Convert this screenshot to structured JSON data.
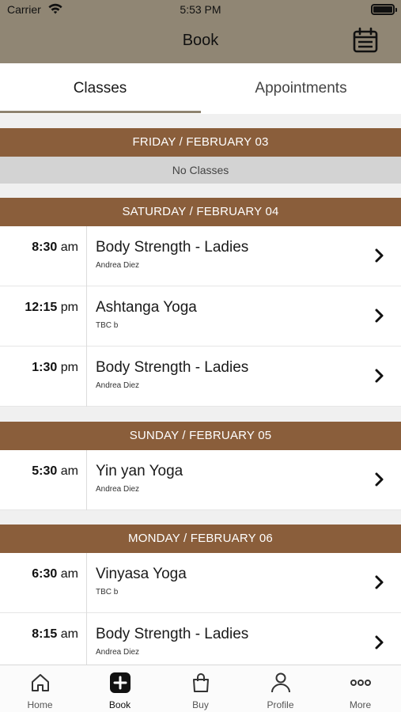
{
  "status_bar": {
    "carrier": "Carrier",
    "time": "5:53 PM"
  },
  "nav": {
    "title": "Book",
    "calendar_icon": "calendar-icon"
  },
  "tabs": [
    {
      "label": "Classes",
      "active": true
    },
    {
      "label": "Appointments",
      "active": false
    }
  ],
  "days": [
    {
      "header": "FRIDAY / FEBRUARY 03",
      "empty_text": "No Classes",
      "classes": []
    },
    {
      "header": "SATURDAY / FEBRUARY 04",
      "classes": [
        {
          "time_num": "8:30",
          "time_suffix": "am",
          "title": "Body Strength - Ladies",
          "instructor": "Andrea Diez"
        },
        {
          "time_num": "12:15",
          "time_suffix": "pm",
          "title": "Ashtanga Yoga",
          "instructor": "TBC b"
        },
        {
          "time_num": "1:30",
          "time_suffix": "pm",
          "title": "Body Strength - Ladies",
          "instructor": "Andrea Diez"
        }
      ]
    },
    {
      "header": "SUNDAY / FEBRUARY 05",
      "classes": [
        {
          "time_num": "5:30",
          "time_suffix": "am",
          "title": "Yin yan Yoga",
          "instructor": "Andrea Diez"
        }
      ]
    },
    {
      "header": "MONDAY / FEBRUARY 06",
      "classes": [
        {
          "time_num": "6:30",
          "time_suffix": "am",
          "title": "Vinyasa Yoga",
          "instructor": "TBC b"
        },
        {
          "time_num": "8:15",
          "time_suffix": "am",
          "title": "Body Strength - Ladies",
          "instructor": "Andrea Diez"
        }
      ]
    }
  ],
  "tabbar": [
    {
      "label": "Home",
      "icon": "home-icon"
    },
    {
      "label": "Book",
      "icon": "plus-icon",
      "active": true
    },
    {
      "label": "Buy",
      "icon": "shopping-bag-icon"
    },
    {
      "label": "Profile",
      "icon": "person-icon"
    },
    {
      "label": "More",
      "icon": "more-icon"
    }
  ],
  "colors": {
    "header_bg": "#908674",
    "day_header_bg": "#8a5e3b",
    "tab_underline": "#8e8370",
    "no_classes_bg": "#d3d3d3"
  }
}
